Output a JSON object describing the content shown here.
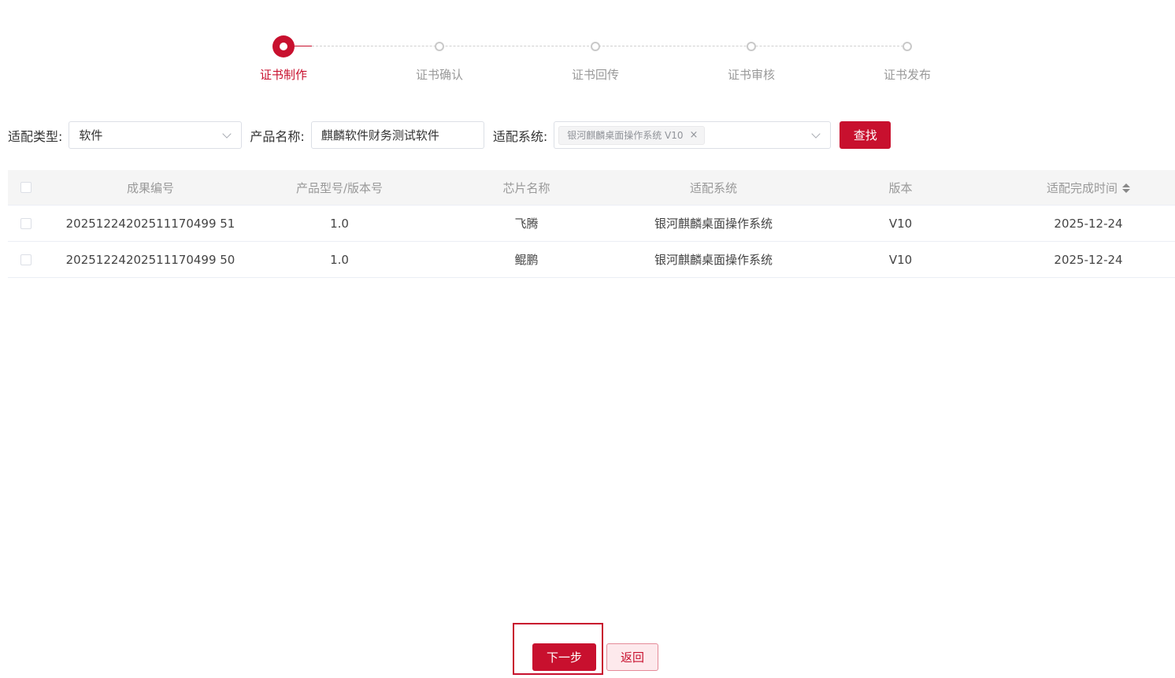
{
  "steps": [
    {
      "label": "证书制作",
      "active": true
    },
    {
      "label": "证书确认",
      "active": false
    },
    {
      "label": "证书回传",
      "active": false
    },
    {
      "label": "证书审核",
      "active": false
    },
    {
      "label": "证书发布",
      "active": false
    }
  ],
  "filters": {
    "type_label": "适配类型:",
    "type_value": "软件",
    "product_label": "产品名称:",
    "product_value": "麒麟软件财务测试软件",
    "system_label": "适配系统:",
    "system_tag": "银河麒麟桌面操作系统 V10",
    "system_tag_close": "×",
    "search_button": "查找"
  },
  "table": {
    "headers": [
      "成果编号",
      "产品型号/版本号",
      "芯片名称",
      "适配系统",
      "版本",
      "适配完成时间"
    ],
    "rows": [
      [
        "20251224202511170499 51",
        "1.0",
        "飞腾",
        "银河麒麟桌面操作系统",
        "V10",
        "2025-12-24"
      ],
      [
        "20251224202511170499 50",
        "1.0",
        "鲲鹏",
        "银河麒麟桌面操作系统",
        "V10",
        "2025-12-24"
      ]
    ]
  },
  "footer": {
    "next_button": "下一步",
    "back_button": "返回"
  },
  "colors": {
    "accent": "#c8102e",
    "muted_text": "#999999",
    "header_bg": "#f5f5f5"
  }
}
